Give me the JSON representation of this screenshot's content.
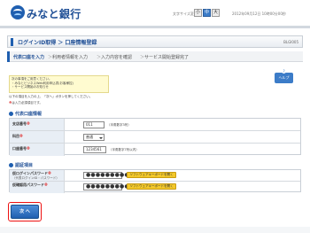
{
  "header": {
    "bank_name": "みなと銀行",
    "font_size_label": "文字サイズ変更",
    "font_size_options": [
      "小",
      "中",
      "大"
    ],
    "login_time": "2012年09月12日 10時00分00秒"
  },
  "page": {
    "title": "ログインID取得 ＞ 口座情報登録",
    "screen_id": "BLGI005"
  },
  "steps": [
    "代表口座を入力",
    "利用者情報を入力",
    "入力内容を確認",
    "サービス開始登録完了"
  ],
  "help_label": "ヘルプ",
  "notice_lines": [
    "次の事項をご用意ください。",
    "・みなとビジネスWeb利用申込書(お客様控)",
    "・サービス開始のお知らせ"
  ],
  "instructions": "以下の項目を入力の上、「次へ」ボタンを押してください。",
  "required_note": {
    "mark": "※",
    "text": "は入力必須項目です。"
  },
  "section_account": {
    "title": "代表口座情報",
    "rows": [
      {
        "label": "支店番号",
        "value": "011",
        "hint": "（半角数字3桁）"
      },
      {
        "label": "科目",
        "value": "普通",
        "hint": ""
      },
      {
        "label": "口座番号",
        "value": "1234561",
        "hint": "（半角数字7桁以内）"
      }
    ]
  },
  "section_auth": {
    "title": "認証項目",
    "rows": [
      {
        "label": "仮ログインパスワード",
        "sub": "（代表ログインID・パスワード）",
        "masked": "●●●●●●●●●",
        "button": "ソフトウェアキーボードを開く"
      },
      {
        "label": "仮確認用パスワード",
        "sub": "",
        "masked": "●●●●●●●●●",
        "button": "ソフトウェアキーボードを開く"
      }
    ]
  },
  "next_button": "次 へ",
  "colors": {
    "brand_blue": "#1f5fb0",
    "notice_yellow": "#fffbd0",
    "required_red": "#dd2222",
    "keyboard_button": "#f3c82a",
    "highlight_red": "#ee1111"
  }
}
